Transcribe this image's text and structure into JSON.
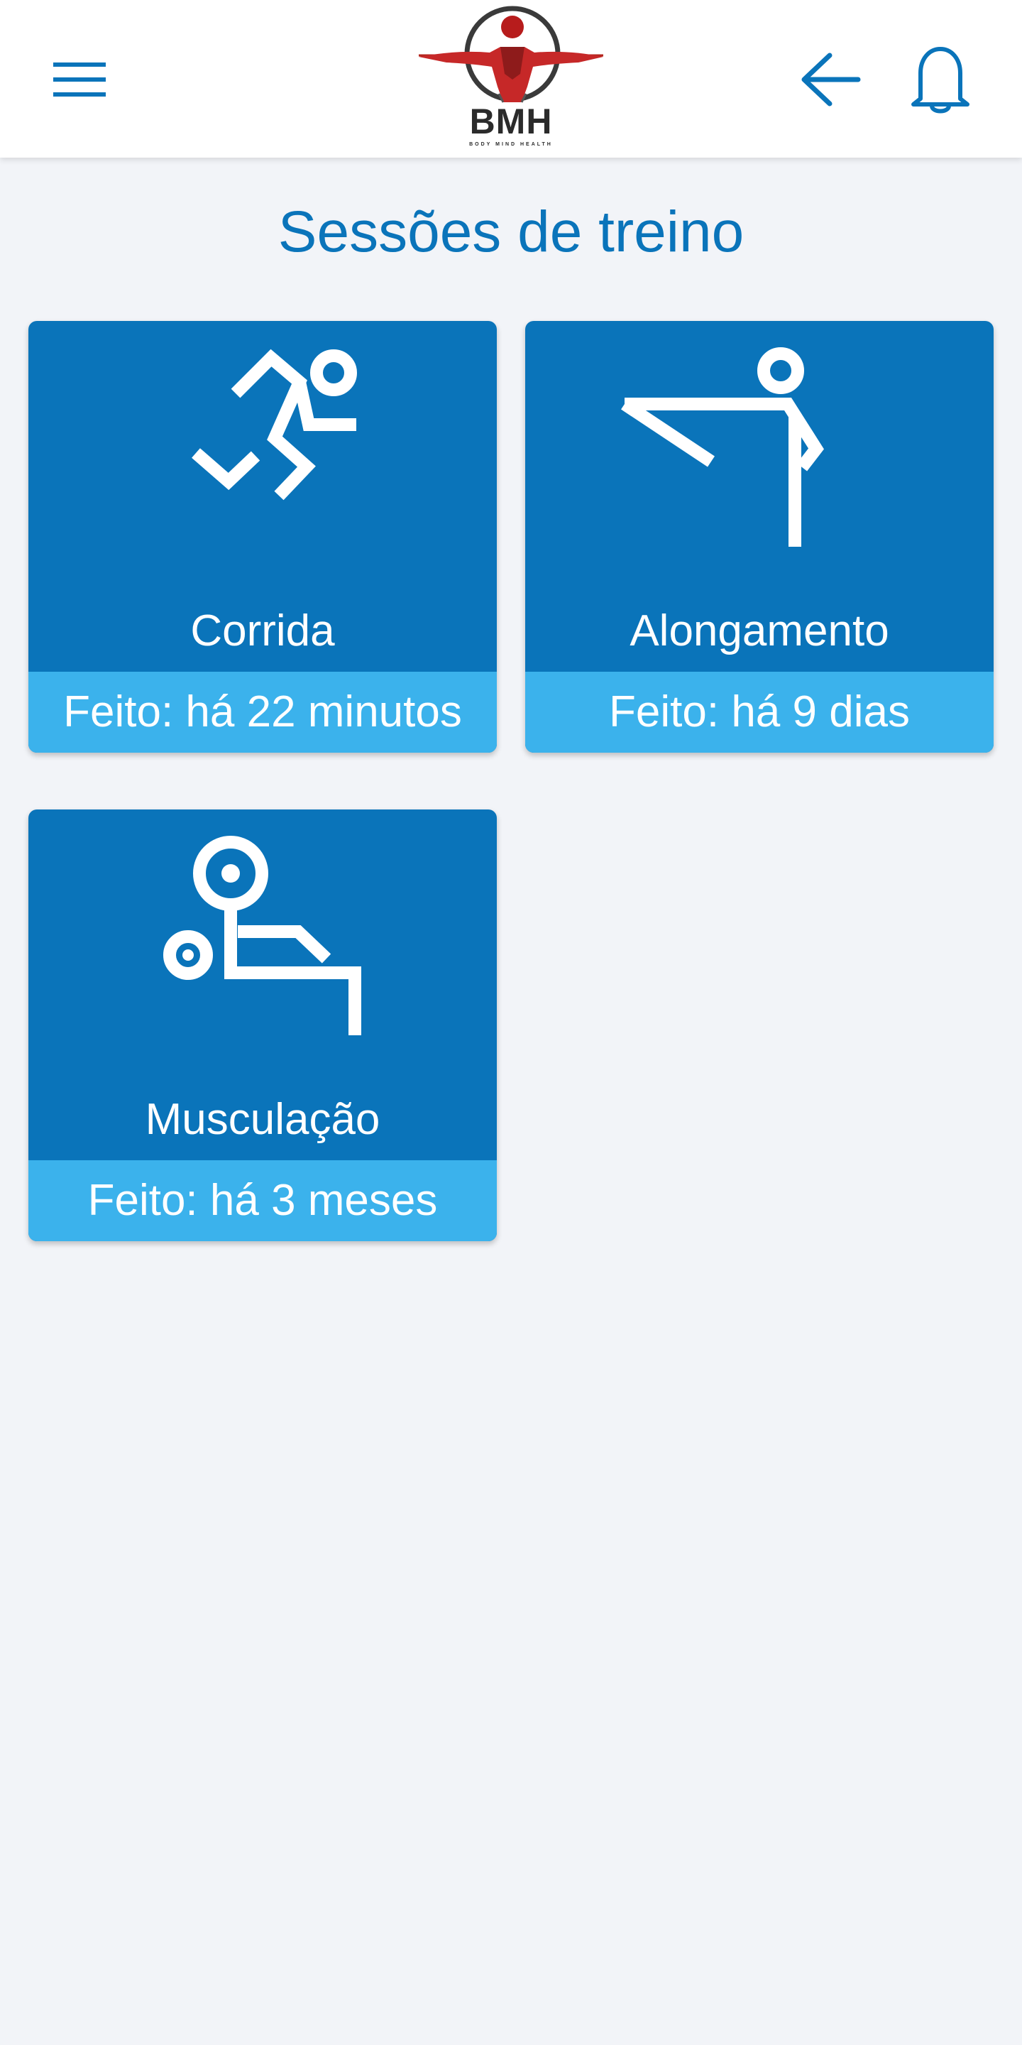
{
  "app": {
    "brand": {
      "logo_text": "BMH",
      "logo_subtext": "BODY MIND HEALTH"
    },
    "icons": {
      "menu": "hamburger-menu-icon",
      "back": "arrow-left-icon",
      "notifications": "bell-icon"
    },
    "colors": {
      "primary": "#0a74ba",
      "accent": "#3bb2ec",
      "background": "#f2f4f8"
    }
  },
  "page": {
    "title": "Sessões de treino"
  },
  "sessions": [
    {
      "label": "Corrida",
      "last_done": "Feito: há 22 minutos",
      "icon": "running-icon"
    },
    {
      "label": "Alongamento",
      "last_done": "Feito: há 9 dias",
      "icon": "stretching-icon"
    },
    {
      "label": "Musculação",
      "last_done": "Feito: há 3 meses",
      "icon": "weightlifting-icon"
    }
  ]
}
